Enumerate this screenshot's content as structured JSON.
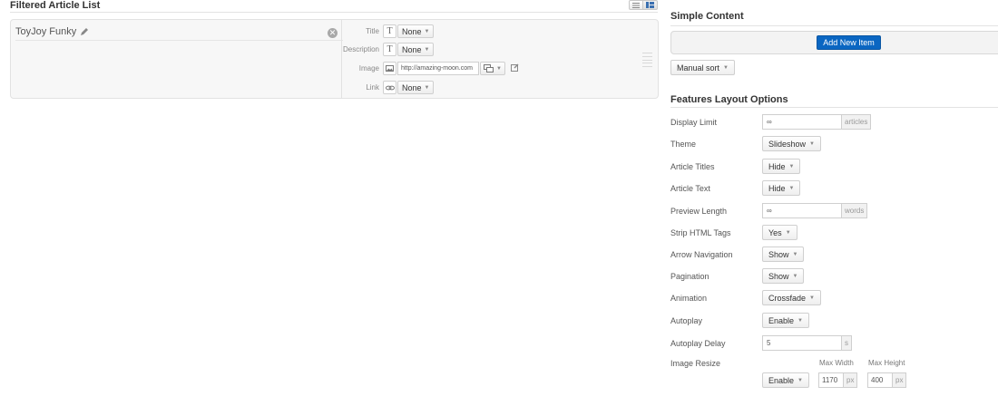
{
  "left": {
    "title": "Filtered Article List",
    "card": {
      "title": "ToyJoy Funky",
      "fields": [
        {
          "label": "Title",
          "icon": "T",
          "value": "None"
        },
        {
          "label": "Description",
          "icon": "T",
          "value": "None"
        },
        {
          "label": "Image",
          "url": "http://amazing-moon.com"
        },
        {
          "label": "Link",
          "value": "None"
        }
      ]
    }
  },
  "right": {
    "simple_content": {
      "title": "Simple Content",
      "add_button": "Add New Item",
      "sort_button": "Manual sort"
    },
    "features": {
      "title": "Features Layout Options",
      "display_limit": {
        "label": "Display Limit",
        "value": "∞",
        "unit": "articles"
      },
      "theme": {
        "label": "Theme",
        "value": "Slideshow"
      },
      "article_titles": {
        "label": "Article Titles",
        "value": "Hide"
      },
      "article_text": {
        "label": "Article Text",
        "value": "Hide"
      },
      "preview_length": {
        "label": "Preview Length",
        "value": "∞",
        "unit": "words"
      },
      "strip_html": {
        "label": "Strip HTML Tags",
        "value": "Yes"
      },
      "arrow_navigation": {
        "label": "Arrow Navigation",
        "value": "Show"
      },
      "pagination": {
        "label": "Pagination",
        "value": "Show"
      },
      "animation": {
        "label": "Animation",
        "value": "Crossfade"
      },
      "autoplay": {
        "label": "Autoplay",
        "value": "Enable"
      },
      "autoplay_delay": {
        "label": "Autoplay Delay",
        "value": "5",
        "unit": "s"
      },
      "image_resize": {
        "label": "Image Resize",
        "value": "Enable",
        "max_width_label": "Max Width",
        "max_width": "1170",
        "max_height_label": "Max Height",
        "max_height": "400",
        "unit": "px"
      }
    }
  },
  "icons": {
    "edit": "pencil-icon",
    "close": "close-icon",
    "drag": "drag-handle-icon",
    "image": "image-icon",
    "link": "link-icon",
    "media": "media-icon"
  },
  "colors": {
    "primary_button": "#0a66c2"
  }
}
